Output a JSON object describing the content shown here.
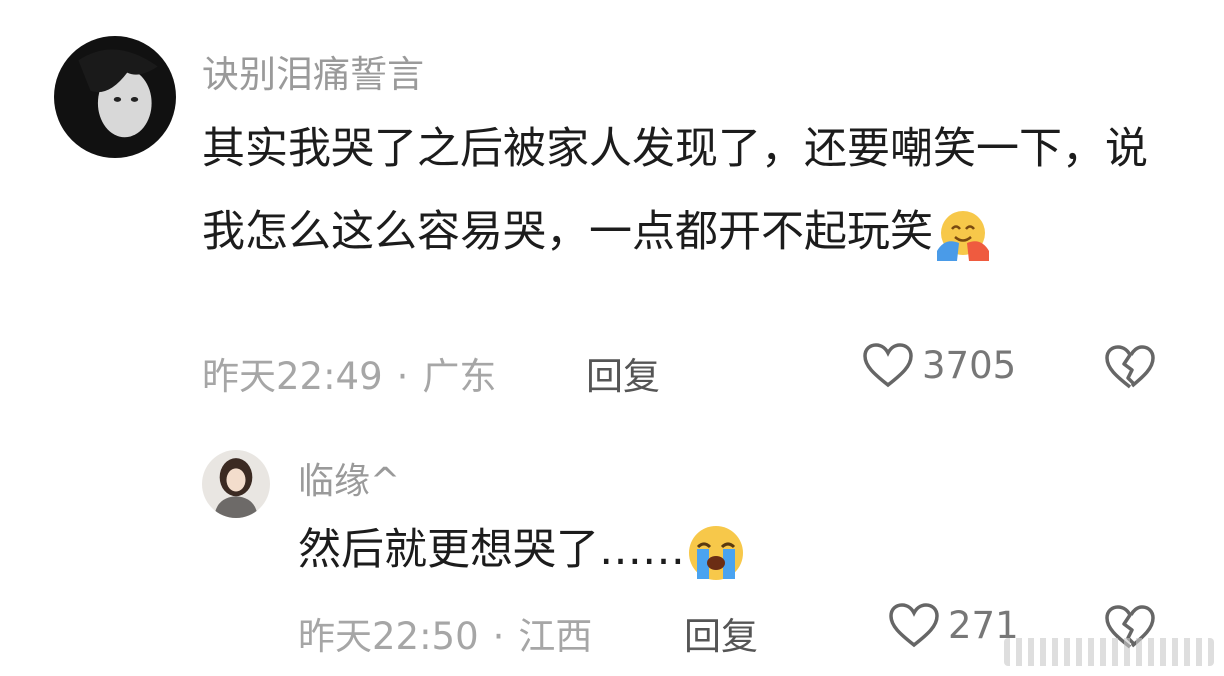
{
  "comments": [
    {
      "username": "诀别泪痛誓言",
      "text": "其实我哭了之后被家人发现了，还要嘲笑一下，说我怎么这么容易哭，一点都开不起玩笑",
      "emoji": "hugging-face-emoji",
      "time": "昨天22:49",
      "location": "广东",
      "reply_label": "回复",
      "like_count": "3705"
    },
    {
      "username": "临缘^",
      "text": "然后就更想哭了……",
      "emoji": "loudly-crying-face-emoji",
      "time": "昨天22:50",
      "location": "江西",
      "reply_label": "回复",
      "like_count": "271"
    }
  ],
  "separator": "·",
  "colors": {
    "username": "#9a9a9a",
    "meta": "#a6a6a6",
    "text": "#1c1c1c"
  }
}
